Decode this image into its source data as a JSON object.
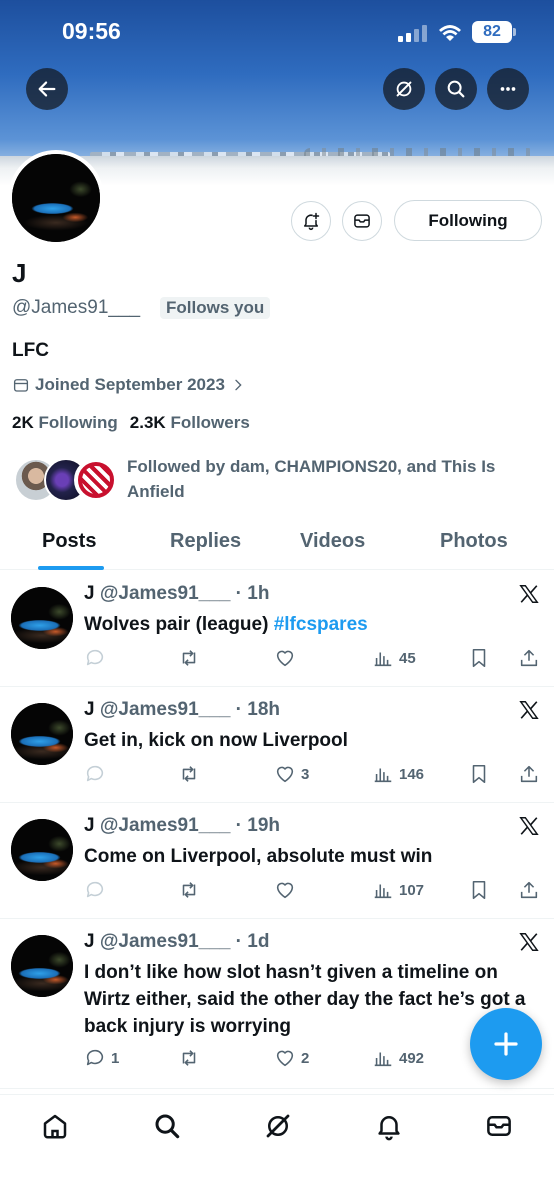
{
  "status_bar": {
    "time": "09:56",
    "battery": "82"
  },
  "header": {
    "buttons": [
      "back",
      "grok",
      "search",
      "more"
    ]
  },
  "profile": {
    "name": "J",
    "handle": "@James91___",
    "follows_you": "Follows you",
    "bio": "LFC",
    "joined": "Joined September 2023",
    "following_count": "2K",
    "following_label": "Following",
    "followers_count": "2.3K",
    "followers_label": "Followers",
    "followed_by": "Followed by dam, CHAMPIONS20, and This Is Anfield",
    "following_button": "Following"
  },
  "tabs": [
    {
      "label": "Posts",
      "active": true
    },
    {
      "label": "Replies",
      "active": false
    },
    {
      "label": "Videos",
      "active": false
    },
    {
      "label": "Photos",
      "active": false
    }
  ],
  "posts": [
    {
      "name": "J",
      "handle": "@James91___",
      "time": "· 1h",
      "text": "Wolves pair (league) ",
      "hashtag": "#lfcspares",
      "replies": "",
      "likes": "",
      "views": "45"
    },
    {
      "name": "J",
      "handle": "@James91___",
      "time": "· 18h",
      "text": "Get in, kick on now Liverpool",
      "hashtag": "",
      "replies": "",
      "likes": "3",
      "views": "146"
    },
    {
      "name": "J",
      "handle": "@James91___",
      "time": "· 19h",
      "text": "Come on Liverpool, absolute must win",
      "hashtag": "",
      "replies": "",
      "likes": "",
      "views": "107"
    },
    {
      "name": "J",
      "handle": "@James91___",
      "time": "· 1d",
      "text": "I don’t like how slot hasn’t given a timeline on Wirtz either, said the other day the fact he’s got a back injury is worrying",
      "hashtag": "",
      "replies": "1",
      "likes": "2",
      "views": "492"
    }
  ],
  "bottom_nav": [
    "home",
    "search",
    "grok",
    "notifications",
    "messages"
  ],
  "colors": {
    "accent": "#1d9bf0",
    "text": "#0f1419",
    "secondary": "#536471"
  }
}
